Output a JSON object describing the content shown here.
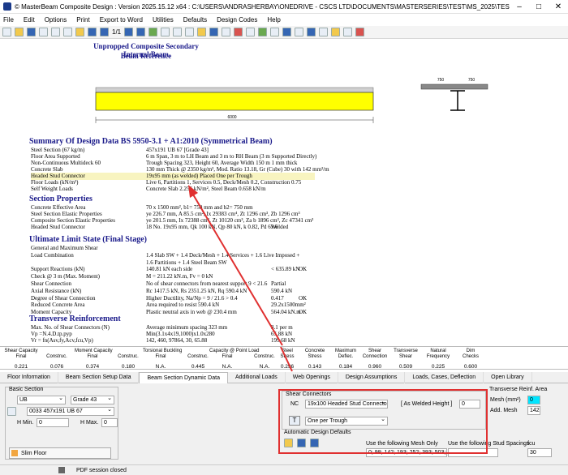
{
  "window": {
    "title": "© MasterBeam Composite Design : Version 2025.15.12 x64 : C:\\USERS\\ANDRASHERBAY\\ONEDRIVE - CSCS LTD\\DOCUMENTS\\MASTERSERIES\\TEST\\MS_2025\\TEST300326"
  },
  "menu": [
    "File",
    "Edit",
    "Options",
    "Print",
    "Export to Word",
    "Utilities",
    "Defaults",
    "Design Codes",
    "Help"
  ],
  "toolbar": {
    "page": "1/1"
  },
  "report": {
    "title1": "Unpropped Composite Secondary Internal Beam",
    "title2": "Beam Reference",
    "dim1": "750",
    "dim2": "750",
    "span": "6000",
    "s1": "Summary Of Design Data BS 5950-3.1 + A1:2010 (Symmetrical Beam)",
    "rows1": [
      [
        "Steel Section (67 kg/m)",
        "457x191 UB 67 [Grade 43]",
        ""
      ],
      [
        "Floor Area Supported",
        "6 m Span, 3 m to LH Beam and 3 m to RH Beam (3 m Supported Directly)",
        ""
      ],
      [
        "Non-Continuous Multideck 60",
        "Trough Spacing 323, Height 60, Average Width  150 m 1 mm thick",
        ""
      ],
      [
        "Concrete Slab",
        "130 mm Thick @ 2350 kg/m³, Mod. Ratio 13.18, Gr (Cube) 30 with 142 mm²/m",
        ""
      ],
      [
        "Headed Stud Connector",
        "19x95 mm (as welded) Placed One per Trough",
        ""
      ],
      [
        "Floor Loads (kN/m²)",
        "Live 6, Partitions 1, Services 0.5, Deck/Mesh 0.2, Construction 0.75",
        ""
      ],
      [
        "Self Weight Loads",
        "Concrete Slab 2.256 kN/m², Steel Beam 0.658 kN/m",
        ""
      ]
    ],
    "s2": "Section Properties",
    "rows2": [
      [
        "Concrete Effective Area",
        "70 x 1500 mm², b1= 750 mm and b2= 750 mm",
        ""
      ],
      [
        "Steel Section Elastic Properties",
        "yе 226.7 mm, A 85.5 cm², Ix 29383 cm⁴, Zt 1296 cm³, Zb 1296 cm³",
        ""
      ],
      [
        "Composite Section Elastic Properties",
        "ye 201.5 mm, Ix 72388 cm⁴, Zt 10120 cm³, Za b 1896 cm³, Zc 47341 cm³",
        ""
      ],
      [
        "Headed Stud Connector",
        "18 No. 19x95 mm, Qk 100 kN, Qp 80 kN, k 0.82, Pd 65.6",
        "Welded"
      ]
    ],
    "s3": "Ultimate Limit State (Final Stage)",
    "rows3": [
      [
        "General and Maximum Shear",
        "",
        "",
        ""
      ],
      [
        "   Load Combination",
        "1.4 Slab SW + 1.4 Deck/Mesh + 1.4 Services + 1.6 Live Imposed +",
        "",
        ""
      ],
      [
        "",
        "1.6 Partitions + 1.4 Steel Beam SW",
        "",
        ""
      ],
      [
        "   Support Reactions (kN)",
        "140.81 kN each side",
        "< 635.89 kN",
        "OK"
      ],
      [
        "Check @ 3 m (Max. Moment)",
        "M = 211.22 kN.m, Fv = 0 kN",
        "",
        ""
      ],
      [
        "   Shear Connection",
        "No of shear connectors from nearest support 9 < 21.6",
        "Partial",
        ""
      ],
      [
        "   Axial Resistance (kN)",
        "Rc 1417.5 kN, Rs 2351.25 kN, Rq 590.4 kN",
        "590.4 kN",
        ""
      ],
      [
        "   Degree of Shear Connection",
        "Higher Ductility, Na/Np = 9 / 21.6 > 0.4",
        "0.417",
        "OK"
      ],
      [
        "   Reduced Concrete Area",
        "Area required to resist 590.4 kN",
        "29.2x1500mm²",
        ""
      ],
      [
        "   Moment Capacity",
        "Plastic neutral axis in web @ 230.4 mm",
        "564.04 kN.m",
        "OK"
      ]
    ],
    "s4": "Transverse Reinforcement",
    "rows4": [
      [
        "   Max. No. of Shear Connectors (N)",
        "Average minimum spacing 323 mm",
        "3.1 per m",
        ""
      ],
      [
        "   Vp =N.4.D.tp.pyp",
        "Min(3.1x4x19,1000)x1.0x280",
        "65.88 kN",
        ""
      ],
      [
        "   Vr = fn(Asv,fy,Acv,fcu,Vp)",
        "142, 460, 97864, 30, 65.88",
        "199.68 kN",
        ""
      ]
    ]
  },
  "results": [
    {
      "h": "Shear Capacity\nFinal",
      "v": "0.221"
    },
    {
      "h": "\nConstruc.",
      "v": "0.076"
    },
    {
      "h": "Moment Capacity\nFinal",
      "v": "0.374"
    },
    {
      "h": "\nConstruc.",
      "v": "0.180"
    },
    {
      "h": "Torsional Buckling\nFinal",
      "v": "N.A."
    },
    {
      "h": "\nConstruc.",
      "v": "0.445"
    },
    {
      "h": "Capacity @ Point Load\nFinal",
      "v": "N.A."
    },
    {
      "h": "\nConstruc.",
      "v": "N.A."
    },
    {
      "h": "Steel\nStress",
      "v": "0.296"
    },
    {
      "h": "Concrete\nStress",
      "v": "0.143"
    },
    {
      "h": "Maximum\nDeflec.",
      "v": "0.184"
    },
    {
      "h": "Shear\nConnection",
      "v": "0.960"
    },
    {
      "h": "Transverse\nShear",
      "v": "0.509"
    },
    {
      "h": "Natural\nFrequency",
      "v": "0.225"
    },
    {
      "h": "Dim\nChecks",
      "v": "0.600"
    }
  ],
  "tabs": [
    "Floor Information",
    "Beam Section Setup Data",
    "Beam Section Dynamic Data",
    "Additional Loads",
    "Web Openings",
    "Design Assumptions",
    "Loads, Cases, Deflection",
    "Open Library"
  ],
  "basic": {
    "label": "Basic Section",
    "type": "UB",
    "grade": "Grade 43",
    "section": "0033 457x191 UB 67",
    "hmin_label": "H Min.",
    "hmin": "0",
    "hmax_label": "H Max.",
    "hmax": "0",
    "slim": "Slim Floor"
  },
  "shear": {
    "label": "Shear Connectors",
    "nc": "NC",
    "stud": "19x100 Headed Stud Connecto",
    "height_label": "[ As Welded Height ]",
    "height": "0",
    "placement": "One per Trough"
  },
  "auto": {
    "label": "Automatic Design Defaults"
  },
  "transverse": {
    "label": "Transverse Reinf. Area",
    "mesh_label": "Mesh (mm²)",
    "mesh": "0",
    "add_label": "Add. Mesh",
    "add": "142"
  },
  "mesh_only": {
    "label": "Use the following Mesh Only",
    "value": "0; 98; 142; 193; 252; 393; 503;"
  },
  "stud_sp": {
    "label": "Use the following Stud Spacings",
    "value": ""
  },
  "fcu": {
    "label": "fcu",
    "value": "30"
  },
  "status": {
    "text": "PDF session closed"
  },
  "colors": {
    "accent": "#1a1a8a",
    "highlight": "#f8f4c0",
    "beam": "#ffff00",
    "redbox": "#e03030",
    "mesh_cyan": "#00e5ff"
  }
}
